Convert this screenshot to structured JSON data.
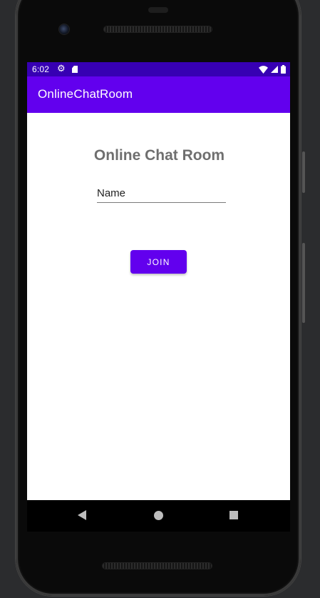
{
  "status_bar": {
    "time": "6:02",
    "icons": [
      "settings-gear-icon",
      "sd-card-icon",
      "wifi-icon",
      "cell-signal-icon",
      "battery-icon"
    ],
    "color": "#3700b3"
  },
  "app_bar": {
    "title": "OnlineChatRoom",
    "color": "#6200ee"
  },
  "main": {
    "heading": "Online Chat Room",
    "name_input": {
      "value": "",
      "placeholder": "Name"
    },
    "join_button": {
      "label": "JOIN",
      "color": "#6200ee"
    }
  },
  "nav_bar": {
    "icons": [
      "back-icon",
      "home-icon",
      "recents-icon"
    ]
  }
}
